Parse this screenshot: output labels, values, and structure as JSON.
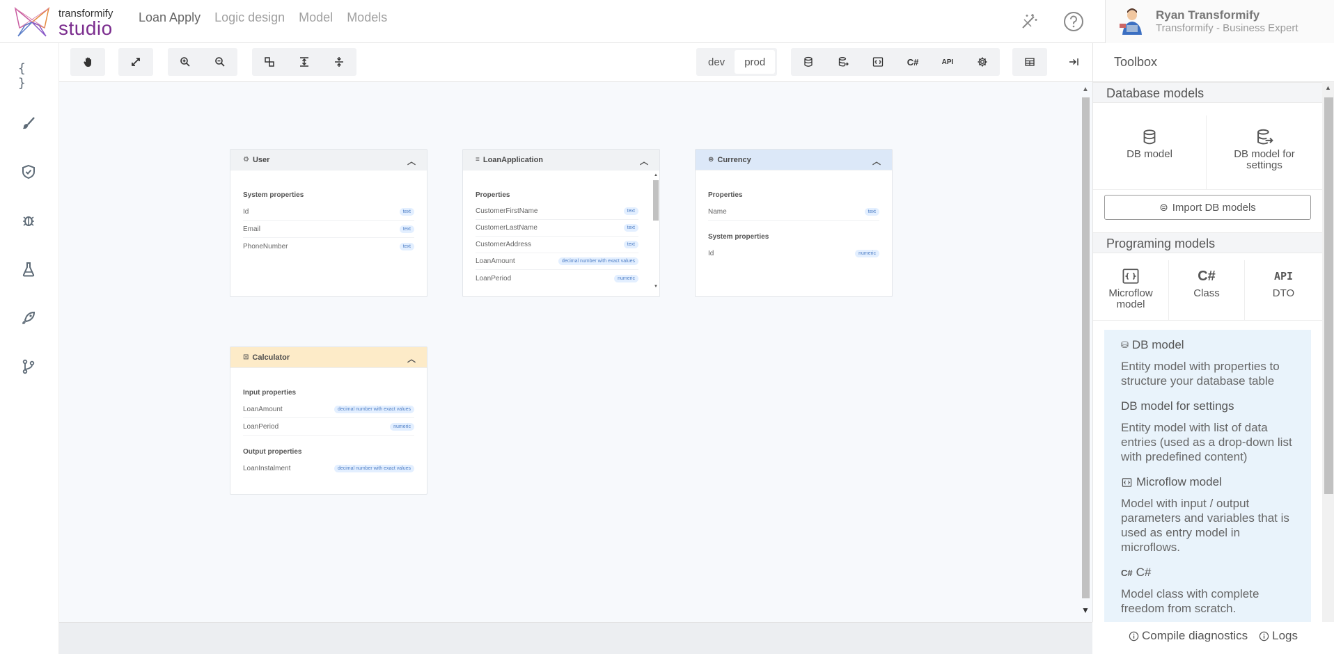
{
  "header": {
    "brand_small": "transformify",
    "brand_big": "studio",
    "nav": [
      "Loan Apply",
      "Logic design",
      "Model",
      "Models"
    ],
    "user_name": "Ryan Transformify",
    "user_role": "Transformify - Business Expert"
  },
  "sidebar": {
    "icons": [
      "braces-icon",
      "brush-icon",
      "shield-check-icon",
      "bug-icon",
      "flask-icon",
      "rocket-icon",
      "branch-icon"
    ]
  },
  "toolbar": {
    "env_dev": "dev",
    "env_prod": "prod",
    "csharp": "C#",
    "api": "API"
  },
  "entities": [
    {
      "title": "User",
      "sections": [
        {
          "title": "System properties",
          "rows": [
            [
              "Id",
              "text"
            ],
            [
              "Email",
              "text"
            ],
            [
              "PhoneNumber",
              "text"
            ]
          ]
        }
      ]
    },
    {
      "title": "LoanApplication",
      "sections": [
        {
          "title": "Properties",
          "rows": [
            [
              "CustomerFirstName",
              "text"
            ],
            [
              "CustomerLastName",
              "text"
            ],
            [
              "CustomerAddress",
              "text"
            ],
            [
              "LoanAmount",
              "decimal number with exact values"
            ],
            [
              "LoanPeriod",
              "numeric"
            ]
          ]
        }
      ]
    },
    {
      "title": "Currency",
      "sections": [
        {
          "title": "Properties",
          "rows": [
            [
              "Name",
              "text"
            ]
          ]
        },
        {
          "title": "System properties",
          "rows": [
            [
              "Id",
              "numeric"
            ]
          ]
        }
      ]
    },
    {
      "title": "Calculator",
      "sections": [
        {
          "title": "Input properties",
          "rows": [
            [
              "LoanAmount",
              "decimal number with exact values"
            ],
            [
              "LoanPeriod",
              "numeric"
            ]
          ]
        },
        {
          "title": "Output properties",
          "rows": [
            [
              "LoanInstalment",
              "decimal number with exact values"
            ]
          ]
        }
      ]
    }
  ],
  "toolbox": {
    "title": "Toolbox",
    "db_section": "Database models",
    "db_model": "DB model",
    "db_model_settings": "DB model for settings",
    "import_btn": "Import DB models",
    "prog_section": "Programing models",
    "microflow": "Microflow model",
    "class": "Class",
    "dto": "DTO",
    "class_glyph": "C#",
    "dto_glyph": "API",
    "info": [
      {
        "title": "DB model",
        "desc": "Entity model with properties to structure your database table"
      },
      {
        "title": "DB model for settings",
        "desc": "Entity model with list of data entries (used as a drop-down list with predefined content)"
      },
      {
        "title": "Microflow model",
        "desc": "Model with input / output parameters and variables that is used as entry model in microflows."
      },
      {
        "title": "C#",
        "desc": "Model class with complete freedom from scratch."
      }
    ],
    "info_cs_glyph": "C#"
  },
  "footer": {
    "compile": "Compile diagnostics",
    "logs": "Logs"
  }
}
